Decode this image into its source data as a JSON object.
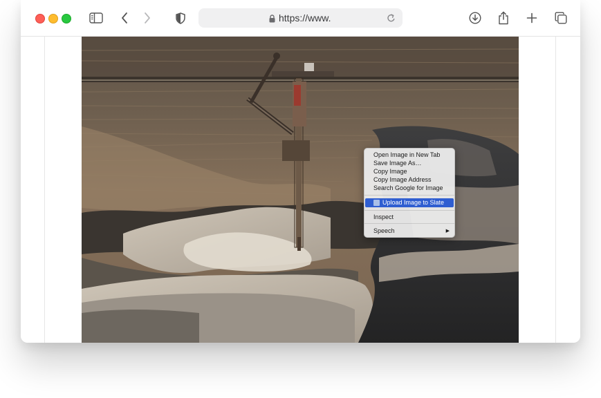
{
  "browser": {
    "url": "https://www.",
    "traffic_lights": {
      "close": "#fe5f57",
      "minimize": "#febc2e",
      "zoom": "#28c840"
    },
    "toolbar_icons": [
      "sidebar-icon",
      "back-icon",
      "forward-icon",
      "shield-icon",
      "lock-icon",
      "reload-icon",
      "download-icon",
      "share-icon",
      "new-tab-icon",
      "tabs-overview-icon"
    ]
  },
  "page": {
    "image_alt": "Aerial photo of a bucket-wheel excavator in an open-pit mine"
  },
  "context_menu": {
    "items": [
      "Open Image in New Tab",
      "Save Image As…",
      "Copy Image",
      "Copy Image Address",
      "Search Google for Image"
    ],
    "highlighted": "Upload Image to Slate",
    "inspect": "Inspect",
    "speech": "Speech",
    "submenu_arrow": "▶",
    "highlight_color": "#2f5ed1"
  }
}
